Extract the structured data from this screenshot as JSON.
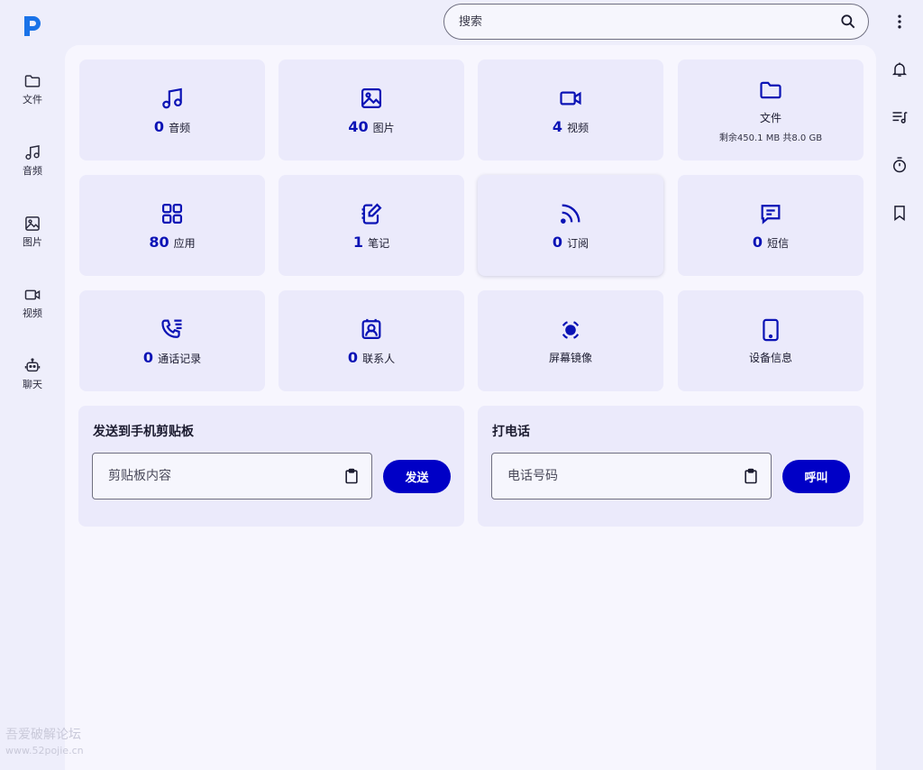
{
  "search": {
    "placeholder": "搜索"
  },
  "sidebar": {
    "items": [
      {
        "label": "文件",
        "icon": "folder-icon"
      },
      {
        "label": "音频",
        "icon": "music-icon"
      },
      {
        "label": "图片",
        "icon": "image-icon"
      },
      {
        "label": "视频",
        "icon": "video-icon"
      },
      {
        "label": "聊天",
        "icon": "robot-icon"
      }
    ]
  },
  "right_rail": [
    "more-vert-icon",
    "bell-icon",
    "playlist-icon",
    "timer-icon",
    "bookmark-icon"
  ],
  "tiles": {
    "audio": {
      "count": "0",
      "label": "音频"
    },
    "images": {
      "count": "40",
      "label": "图片"
    },
    "video": {
      "count": "4",
      "label": "视频"
    },
    "files": {
      "label": "文件",
      "sub": "剩余450.1 MB 共8.0 GB"
    },
    "apps": {
      "count": "80",
      "label": "应用"
    },
    "notes": {
      "count": "1",
      "label": "笔记"
    },
    "feeds": {
      "count": "0",
      "label": "订阅"
    },
    "sms": {
      "count": "0",
      "label": "短信"
    },
    "calls": {
      "count": "0",
      "label": "通话记录"
    },
    "contacts": {
      "count": "0",
      "label": "联系人"
    },
    "mirror": {
      "label": "屏幕镜像"
    },
    "device": {
      "label": "设备信息"
    }
  },
  "clipboard": {
    "title": "发送到手机剪贴板",
    "placeholder": "剪贴板内容",
    "button": "发送"
  },
  "call": {
    "title": "打电话",
    "placeholder": "电话号码",
    "button": "呼叫"
  },
  "watermark": {
    "line1": "吾爱破解论坛",
    "line2": "www.52pojie.cn"
  },
  "colors": {
    "accent": "#0000c6",
    "count_text": "#0b13b5",
    "tile_bg": "#ebeafb",
    "page_bg": "#eeeefb"
  }
}
